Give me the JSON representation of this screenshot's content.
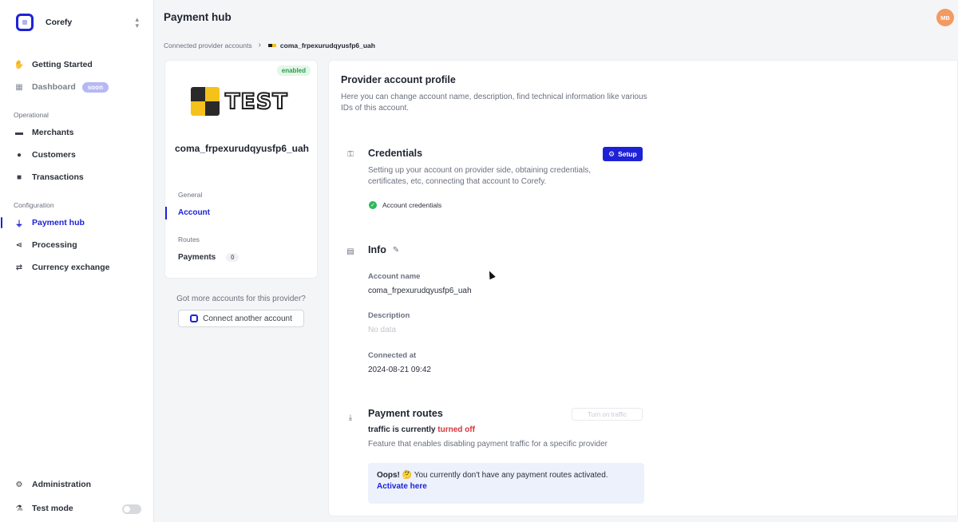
{
  "workspace": {
    "name": "Corefy"
  },
  "sidebar": {
    "items": [
      {
        "label": "Getting Started",
        "icon": "waving-hand-icon"
      },
      {
        "label": "Dashboard",
        "badge": "soon",
        "icon": "dashboard-grid-icon"
      },
      {
        "label": "Merchants",
        "icon": "store-icon"
      },
      {
        "label": "Customers",
        "icon": "users-icon"
      },
      {
        "label": "Transactions",
        "icon": "transactions-icon"
      },
      {
        "label": "Payment hub",
        "icon": "plug-icon",
        "active": true
      },
      {
        "label": "Processing",
        "icon": "processing-flow-icon"
      },
      {
        "label": "Currency exchange",
        "icon": "exchange-arrows-icon"
      }
    ],
    "groups": {
      "operational": "Operational",
      "configuration": "Configuration"
    },
    "footer": {
      "administration": "Administration",
      "test_mode": "Test mode"
    }
  },
  "header": {
    "title": "Payment hub",
    "avatar_initials": "MB",
    "breadcrumb": {
      "parent": "Connected provider accounts",
      "current": "coma_frpexurudqyusfp6_uah"
    }
  },
  "account_card": {
    "status": "enabled",
    "logo_text": "TEST",
    "name": "coma_frpexurudqyusfp6_uah",
    "general_label": "General",
    "account_link": "Account",
    "routes_label": "Routes",
    "payments_link": "Payments",
    "payments_count": "0"
  },
  "more_accounts": {
    "question": "Got more accounts for this provider?",
    "button": "Connect another account"
  },
  "profile": {
    "title": "Provider account profile",
    "description": "Here you can change account name, description, find technical information like various IDs of this account.",
    "credentials": {
      "title": "Credentials",
      "setup_button": "Setup",
      "description": "Setting up your account on provider side, obtaining credentials, certificates, etc, connecting that account to Corefy.",
      "item": "Account credentials"
    },
    "info": {
      "title": "Info",
      "account_name_label": "Account name",
      "account_name": "coma_frpexurudqyusfp6_uah",
      "description_label": "Description",
      "description": "No data",
      "connected_at_label": "Connected at",
      "connected_at": "2024-08-21 09:42"
    },
    "payment_routes": {
      "title": "Payment routes",
      "turn_on_button": "Turn on traffic",
      "traffic_prefix": "traffic is currently",
      "traffic_state": "turned off",
      "feature_desc": "Feature that enables disabling payment traffic for a specific provider",
      "oops_title": "Oops!",
      "oops_emoji": "🤔",
      "oops_text": "You currently don't have any payment routes activated.",
      "activate_link": "Activate here"
    }
  },
  "colors": {
    "accent": "#1e22d6",
    "success": "#2eb85c",
    "danger": "#d8343a",
    "avatar": "#f29a63"
  }
}
